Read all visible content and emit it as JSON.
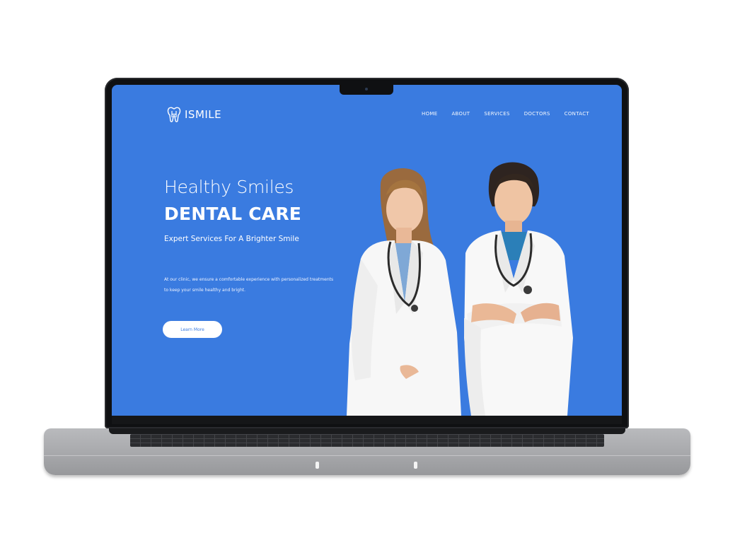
{
  "site": {
    "brand": "ISMILE",
    "nav": [
      "HOME",
      "ABOUT",
      "SERVICES",
      "DOCTORS",
      "CONTACT"
    ],
    "hero": {
      "heading": "Healthy Smiles",
      "title": "DENTAL CARE",
      "subtitle": "Expert Services For A Brighter Smile",
      "body": "At our clinic, we ensure a comfortable experience with personalized treatments to keep your smile healthy and bright.",
      "cta": "Learn More"
    }
  },
  "colors": {
    "screen_background": "#3a7be0",
    "text": "#ffffff",
    "button_background": "#ffffff",
    "button_text": "#3a7be0"
  },
  "icons": {
    "logo": "tooth-icon"
  }
}
